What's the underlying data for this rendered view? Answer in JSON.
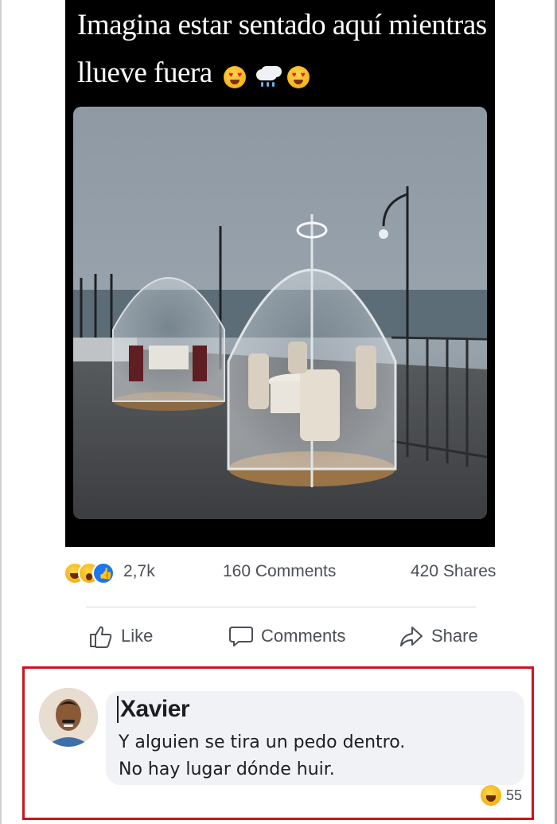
{
  "meme": {
    "caption": "Imagina estar sentado aquí mientras llueve fuera",
    "caption_emojis": [
      "heart-eyes-emoji-icon",
      "rain-cloud-emoji-icon",
      "heart-eyes-emoji-icon"
    ]
  },
  "post_stats": {
    "reaction_icons": [
      "haha-reaction-icon",
      "wow-reaction-icon",
      "like-reaction-icon"
    ],
    "reactions_count": "2,7k",
    "comments": "160 Comments",
    "shares": "420 Shares"
  },
  "actions": {
    "like_label": "Like",
    "comments_label": "Comments",
    "share_label": "Share"
  },
  "comment": {
    "author": "Xavier",
    "text_line1": "Y alguien se tira un pedo dentro.",
    "text_line2": "No hay lugar dónde huir.",
    "reaction_icon": "haha-reaction-icon",
    "reaction_count": "55"
  },
  "colors": {
    "highlight_border": "#c8161d",
    "like_blue": "#1877f2",
    "bubble_bg": "#f0f2f5"
  }
}
